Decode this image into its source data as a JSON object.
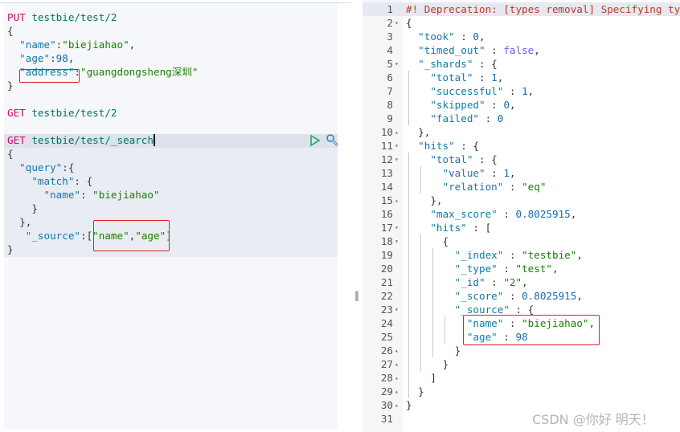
{
  "request_editor": {
    "lines": [
      [
        [
          "PUT",
          "m"
        ],
        [
          " testbie/test/2",
          "p"
        ]
      ],
      [
        [
          "{",
          "x"
        ]
      ],
      [
        [
          "  \"name\"",
          "k"
        ],
        [
          ":",
          "x"
        ],
        [
          "\"biejiahao\"",
          "s"
        ],
        [
          ",",
          "x"
        ]
      ],
      [
        [
          "  \"age\"",
          "k"
        ],
        [
          ":",
          "x"
        ],
        [
          "98",
          "n"
        ],
        [
          ",",
          "x"
        ]
      ],
      [
        [
          "  \"address\"",
          "k"
        ],
        [
          ":",
          "x"
        ],
        [
          "\"guangdongsheng深圳\"",
          "s"
        ]
      ],
      [
        [
          "}",
          "x"
        ]
      ],
      [],
      [
        [
          "GET",
          "m"
        ],
        [
          " testbie/test/2",
          "p"
        ]
      ],
      [],
      [
        [
          "GET",
          "m"
        ],
        [
          " testbie/test/_search",
          "p"
        ]
      ],
      [
        [
          "{",
          "x"
        ]
      ],
      [
        [
          "  \"query\"",
          "k"
        ],
        [
          ":{",
          "x"
        ]
      ],
      [
        [
          "    \"match\"",
          "k"
        ],
        [
          ": {",
          "x"
        ]
      ],
      [
        [
          "      \"name\"",
          "k"
        ],
        [
          ": ",
          "x"
        ],
        [
          "\"biejiahao\"",
          "s"
        ]
      ],
      [
        [
          "    }",
          "x"
        ]
      ],
      [
        [
          "  },",
          "x"
        ]
      ],
      [
        [
          "   \"_source\"",
          "k"
        ],
        [
          ":[",
          "x"
        ],
        [
          "\"name\"",
          "s"
        ],
        [
          ",",
          "x"
        ],
        [
          "\"age\"",
          "s"
        ],
        [
          "]",
          "x"
        ]
      ],
      [
        [
          "}",
          "x"
        ]
      ]
    ],
    "actions": {
      "run_icon": "play-icon",
      "settings_icon": "wrench-icon"
    }
  },
  "response_viewer": {
    "line_numbers": [
      "1",
      "2",
      "3",
      "4",
      "5",
      "6",
      "7",
      "8",
      "9",
      "10",
      "11",
      "12",
      "13",
      "14",
      "15",
      "16",
      "17",
      "18",
      "19",
      "20",
      "21",
      "22",
      "23",
      "24",
      "25",
      "26",
      "27",
      "28",
      "29",
      "30",
      "31"
    ],
    "folds": [
      "",
      "▾",
      "",
      "",
      "▾",
      "",
      "",
      "",
      "",
      "▴",
      "▾",
      "▾",
      "",
      "",
      "▴",
      "",
      "▾",
      "▾",
      "",
      "",
      "",
      "",
      "▾",
      "",
      "",
      "▴",
      "▴",
      "▴",
      "▴",
      "▴",
      ""
    ],
    "lines": [
      [
        [
          "#! Deprecation: [types removal] Specifying ty",
          "c"
        ]
      ],
      [
        [
          "{",
          "x"
        ]
      ],
      [
        [
          "  \"took\"",
          "k"
        ],
        [
          " : ",
          "x"
        ],
        [
          "0",
          "n"
        ],
        [
          ",",
          "x"
        ]
      ],
      [
        [
          "  \"timed_out\"",
          "k"
        ],
        [
          " : ",
          "x"
        ],
        [
          "false",
          "b"
        ],
        [
          ",",
          "x"
        ]
      ],
      [
        [
          "  \"_shards\"",
          "k"
        ],
        [
          " : {",
          "x"
        ]
      ],
      [
        [
          "    \"total\"",
          "k"
        ],
        [
          " : ",
          "x"
        ],
        [
          "1",
          "n"
        ],
        [
          ",",
          "x"
        ]
      ],
      [
        [
          "    \"successful\"",
          "k"
        ],
        [
          " : ",
          "x"
        ],
        [
          "1",
          "n"
        ],
        [
          ",",
          "x"
        ]
      ],
      [
        [
          "    \"skipped\"",
          "k"
        ],
        [
          " : ",
          "x"
        ],
        [
          "0",
          "n"
        ],
        [
          ",",
          "x"
        ]
      ],
      [
        [
          "    \"failed\"",
          "k"
        ],
        [
          " : ",
          "x"
        ],
        [
          "0",
          "n"
        ]
      ],
      [
        [
          "  },",
          "x"
        ]
      ],
      [
        [
          "  \"hits\"",
          "k"
        ],
        [
          " : {",
          "x"
        ]
      ],
      [
        [
          "    \"total\"",
          "k"
        ],
        [
          " : {",
          "x"
        ]
      ],
      [
        [
          "      \"value\"",
          "k"
        ],
        [
          " : ",
          "x"
        ],
        [
          "1",
          "n"
        ],
        [
          ",",
          "x"
        ]
      ],
      [
        [
          "      \"relation\"",
          "k"
        ],
        [
          " : ",
          "x"
        ],
        [
          "\"eq\"",
          "s"
        ]
      ],
      [
        [
          "    },",
          "x"
        ]
      ],
      [
        [
          "    \"max_score\"",
          "k"
        ],
        [
          " : ",
          "x"
        ],
        [
          "0.8025915",
          "n"
        ],
        [
          ",",
          "x"
        ]
      ],
      [
        [
          "    \"hits\"",
          "k"
        ],
        [
          " : [",
          "x"
        ]
      ],
      [
        [
          "      {",
          "x"
        ]
      ],
      [
        [
          "        \"_index\"",
          "k"
        ],
        [
          " : ",
          "x"
        ],
        [
          "\"testbie\"",
          "s"
        ],
        [
          ",",
          "x"
        ]
      ],
      [
        [
          "        \"_type\"",
          "k"
        ],
        [
          " : ",
          "x"
        ],
        [
          "\"test\"",
          "s"
        ],
        [
          ",",
          "x"
        ]
      ],
      [
        [
          "        \"_id\"",
          "k"
        ],
        [
          " : ",
          "x"
        ],
        [
          "\"2\"",
          "s"
        ],
        [
          ",",
          "x"
        ]
      ],
      [
        [
          "        \"_score\"",
          "k"
        ],
        [
          " : ",
          "x"
        ],
        [
          "0.8025915",
          "n"
        ],
        [
          ",",
          "x"
        ]
      ],
      [
        [
          "        \"_source\"",
          "k"
        ],
        [
          " : {",
          "x"
        ]
      ],
      [
        [
          "          \"name\"",
          "k"
        ],
        [
          " : ",
          "x"
        ],
        [
          "\"biejiahao\"",
          "s"
        ],
        [
          ",",
          "x"
        ]
      ],
      [
        [
          "          \"age\"",
          "k"
        ],
        [
          " : ",
          "x"
        ],
        [
          "98",
          "n"
        ]
      ],
      [
        [
          "        }",
          "x"
        ]
      ],
      [
        [
          "      }",
          "x"
        ]
      ],
      [
        [
          "    ]",
          "x"
        ]
      ],
      [
        [
          "  }",
          "x"
        ]
      ],
      [
        [
          "}",
          "x"
        ]
      ],
      []
    ]
  },
  "divider_glyph": "‖",
  "watermark": "CSDN @你好 明天！",
  "colors": {
    "method": "#c80a68",
    "key": "#0f7aa6",
    "string": "#1a7f00",
    "number": "#1469b3",
    "highlight_box": "#e02020"
  }
}
